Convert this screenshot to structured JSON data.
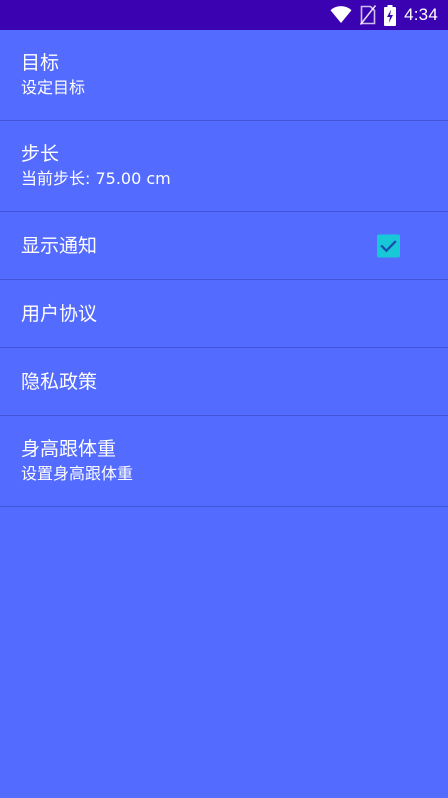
{
  "status_bar": {
    "time": "4:34",
    "icons": [
      "wifi-icon",
      "no-sim-icon",
      "battery-charging-icon"
    ],
    "background": "#3b02b2"
  },
  "colors": {
    "background": "#546bff",
    "checkbox": "#17c9d6",
    "text": "#ffffff"
  },
  "settings": {
    "goal": {
      "title": "目标",
      "summary": "设定目标"
    },
    "stride": {
      "title": "步长",
      "summary": "当前步长: 75.00 cm"
    },
    "notification": {
      "title": "显示通知",
      "checked": true
    },
    "user_agreement": {
      "title": "用户协议"
    },
    "privacy_policy": {
      "title": "隐私政策"
    },
    "height_weight": {
      "title": "身高跟体重",
      "summary": "设置身高跟体重"
    }
  }
}
